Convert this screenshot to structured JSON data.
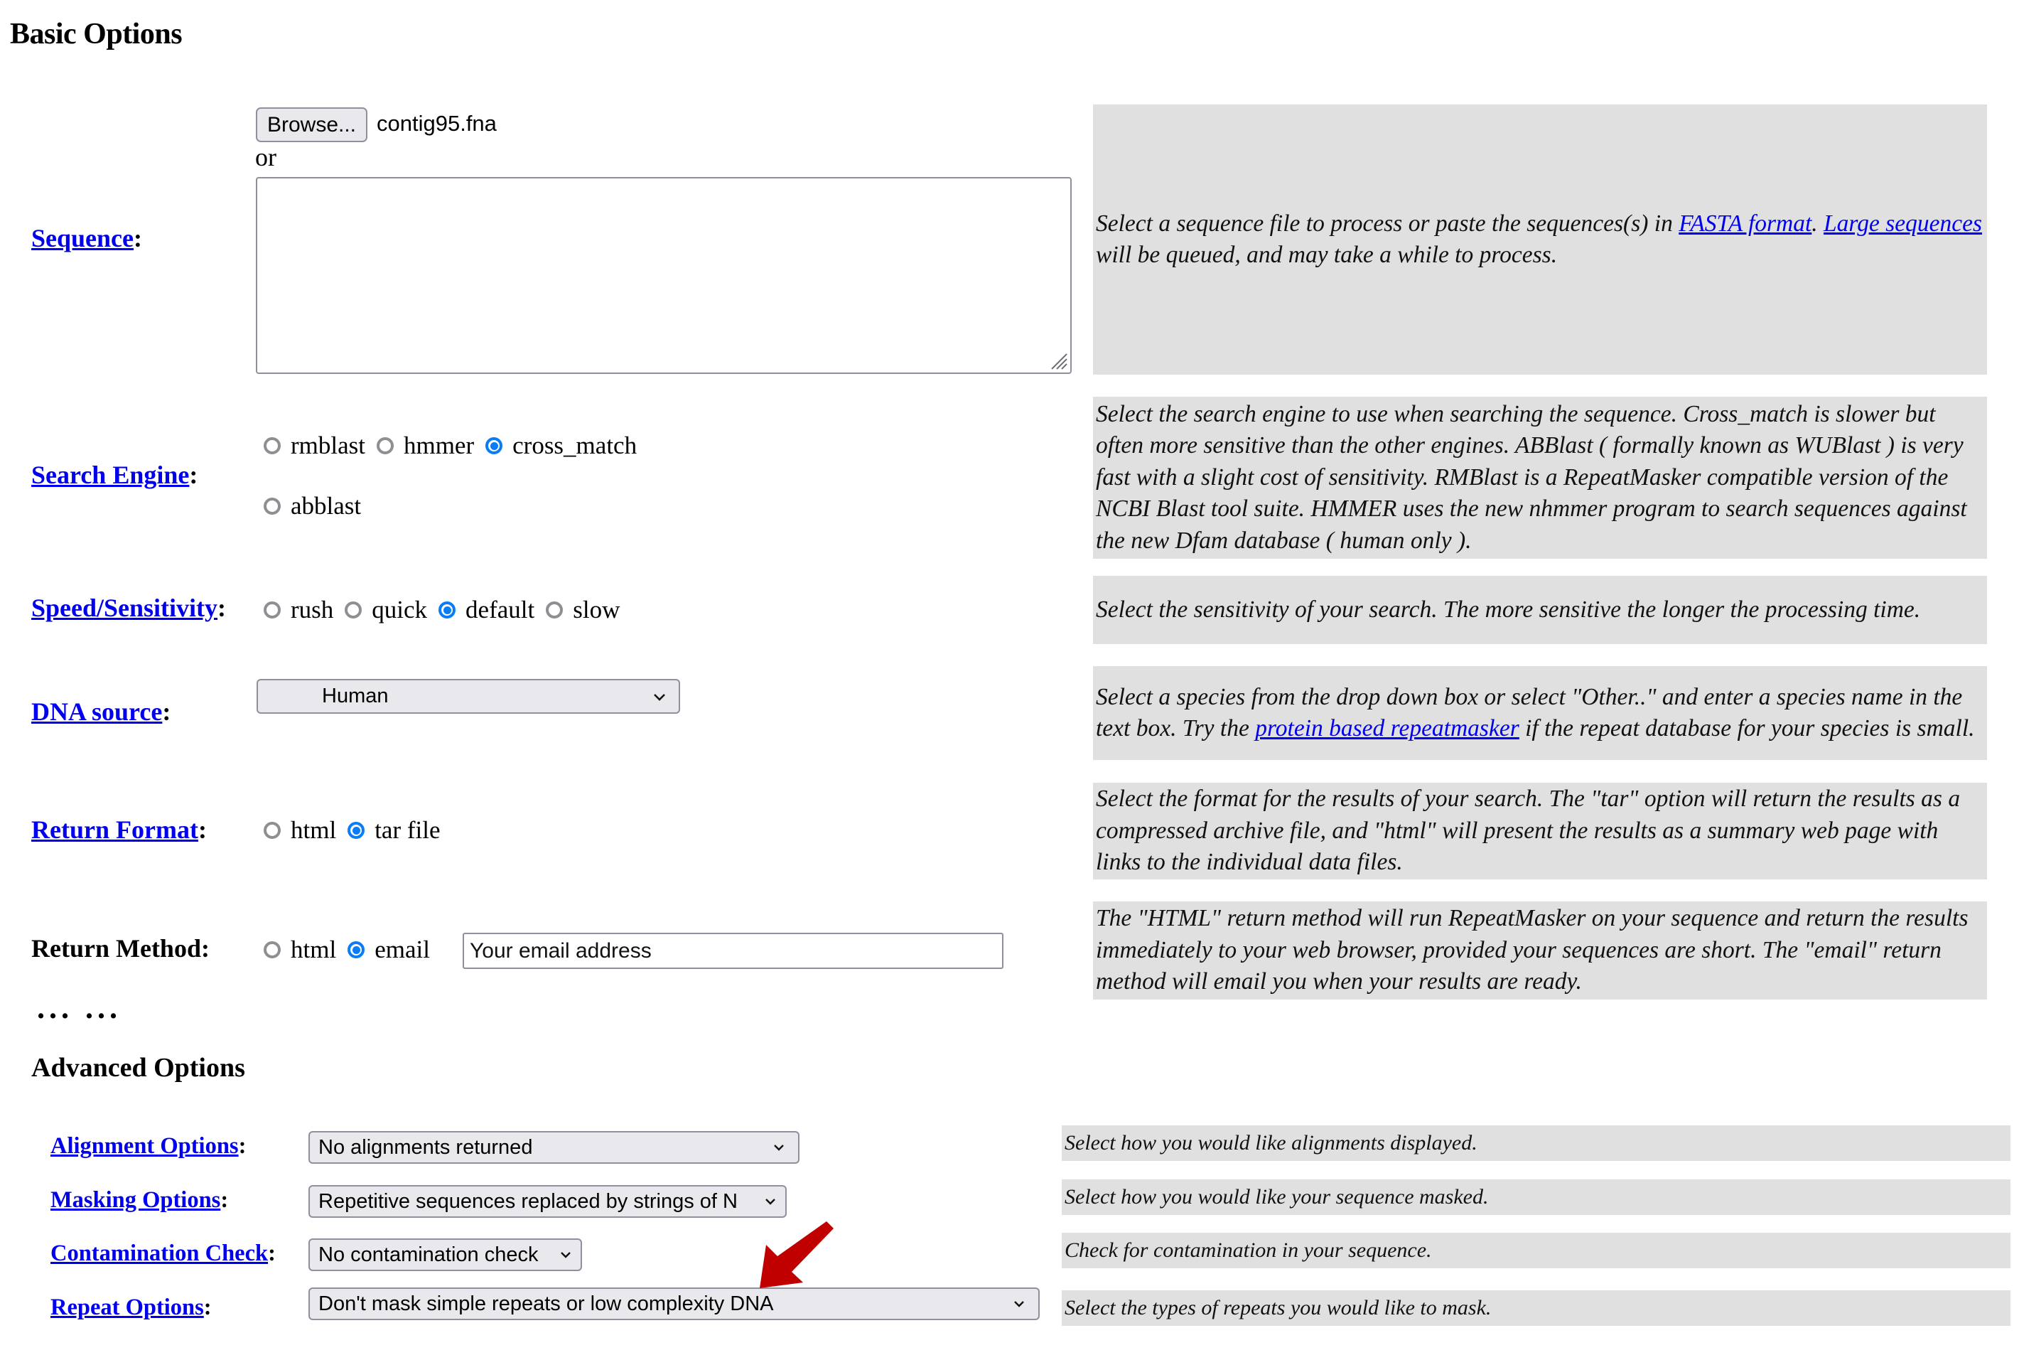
{
  "basic": {
    "title": "Basic Options",
    "sequence": {
      "label": "Sequence",
      "colon": ":",
      "browse_label": "Browse...",
      "file_name": "contig95.fna",
      "or_text": "or",
      "textarea_value": "",
      "desc_part1": "Select a sequence file to process or paste the sequences(s) in ",
      "desc_link1": "FASTA format",
      "desc_part2": ". ",
      "desc_link2": "Large sequences",
      "desc_part3": " will be queued, and may take a while to process."
    },
    "search_engine": {
      "label": "Search Engine",
      "colon": ":",
      "options": [
        {
          "label": "rmblast",
          "selected": false
        },
        {
          "label": "hmmer",
          "selected": false
        },
        {
          "label": "cross_match",
          "selected": true
        },
        {
          "label": "abblast",
          "selected": false
        }
      ],
      "desc": "Select the search engine to use when searching the sequence. Cross_match is slower but often more sensitive than the other engines. ABBlast ( formally known as WUBlast ) is very fast with a slight cost of sensitivity. RMBlast is a RepeatMasker compatible version of the NCBI Blast tool suite. HMMER uses the new nhmmer program to search sequences against the new Dfam database ( human only )."
    },
    "speed": {
      "label": "Speed/Sensitivity",
      "colon": ":",
      "options": [
        {
          "label": "rush",
          "selected": false
        },
        {
          "label": "quick",
          "selected": false
        },
        {
          "label": "default",
          "selected": true
        },
        {
          "label": "slow",
          "selected": false
        }
      ],
      "desc": "Select the sensitivity of your search. The more sensitive the longer the processing time."
    },
    "dna_source": {
      "label": "DNA source",
      "colon": ":",
      "selected": "Human",
      "desc_part1": "Select a species from the drop down box or select \"Other..\" and enter a species name in the text box. Try the ",
      "desc_link": "protein based repeatmasker",
      "desc_part2": " if the repeat database for your species is small."
    },
    "return_format": {
      "label": "Return Format",
      "colon": ":",
      "options": [
        {
          "label": "html",
          "selected": false
        },
        {
          "label": "tar file",
          "selected": true
        }
      ],
      "desc": "Select the format for the results of your search. The \"tar\" option will return the results as a compressed archive file, and \"html\" will present the results as a summary web page with links to the individual data files."
    },
    "return_method": {
      "label": "Return Method:",
      "options": [
        {
          "label": "html",
          "selected": false
        },
        {
          "label": "email",
          "selected": true
        }
      ],
      "email_value": "Your email address",
      "desc": "The \"HTML\" return method will run RepeatMasker on your sequence and return the results immediately to your web browser, provided your sequences are short. The \"email\" return method will email you when your results are ready."
    }
  },
  "ellipsis": "... ...",
  "advanced": {
    "title": "Advanced Options",
    "rows": [
      {
        "label": "Alignment Options",
        "colon": ":",
        "selected": "No alignments returned",
        "desc": "Select how you would like alignments displayed."
      },
      {
        "label": "Masking Options",
        "colon": ":",
        "selected": "Repetitive sequences replaced by strings of N",
        "desc": "Select how you would like your sequence masked."
      },
      {
        "label": "Contamination Check",
        "colon": ":",
        "selected": "No contamination check",
        "desc": "Check for contamination in your sequence."
      },
      {
        "label": "Repeat Options",
        "colon": ":",
        "selected": "Don't mask simple repeats or low complexity DNA",
        "desc": "Select the types of repeats you would like to mask."
      }
    ]
  },
  "annotation": {
    "arrow_color": "#c00000",
    "arrow_target": "repeat-options-select"
  },
  "colors": {
    "link": "#0000ee",
    "desc_background": "#e0e0e0",
    "radio_selected": "#0a7cf5",
    "control_background": "#e9e9ed"
  }
}
